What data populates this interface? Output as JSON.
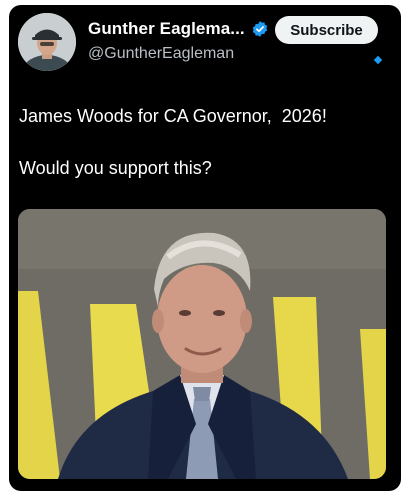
{
  "post": {
    "author": {
      "display_name": "Gunther Eaglema...",
      "handle": "@GuntherEagleman",
      "verified": true,
      "avatar_icon": "profile-photo"
    },
    "subscribe_label": "Subscribe",
    "text_line1": "James Woods for CA Governor,  2026!",
    "text_line2": "Would you support this?",
    "media": {
      "description_icon": "photo"
    }
  },
  "colors": {
    "background": "#000000",
    "text": "#ffffff",
    "handle": "#b9bfc6",
    "verified": "#1d9bf0",
    "subscribe_bg": "#eff3f4",
    "subscribe_text": "#0f1419",
    "accent_yellow": "#e7d84a"
  }
}
